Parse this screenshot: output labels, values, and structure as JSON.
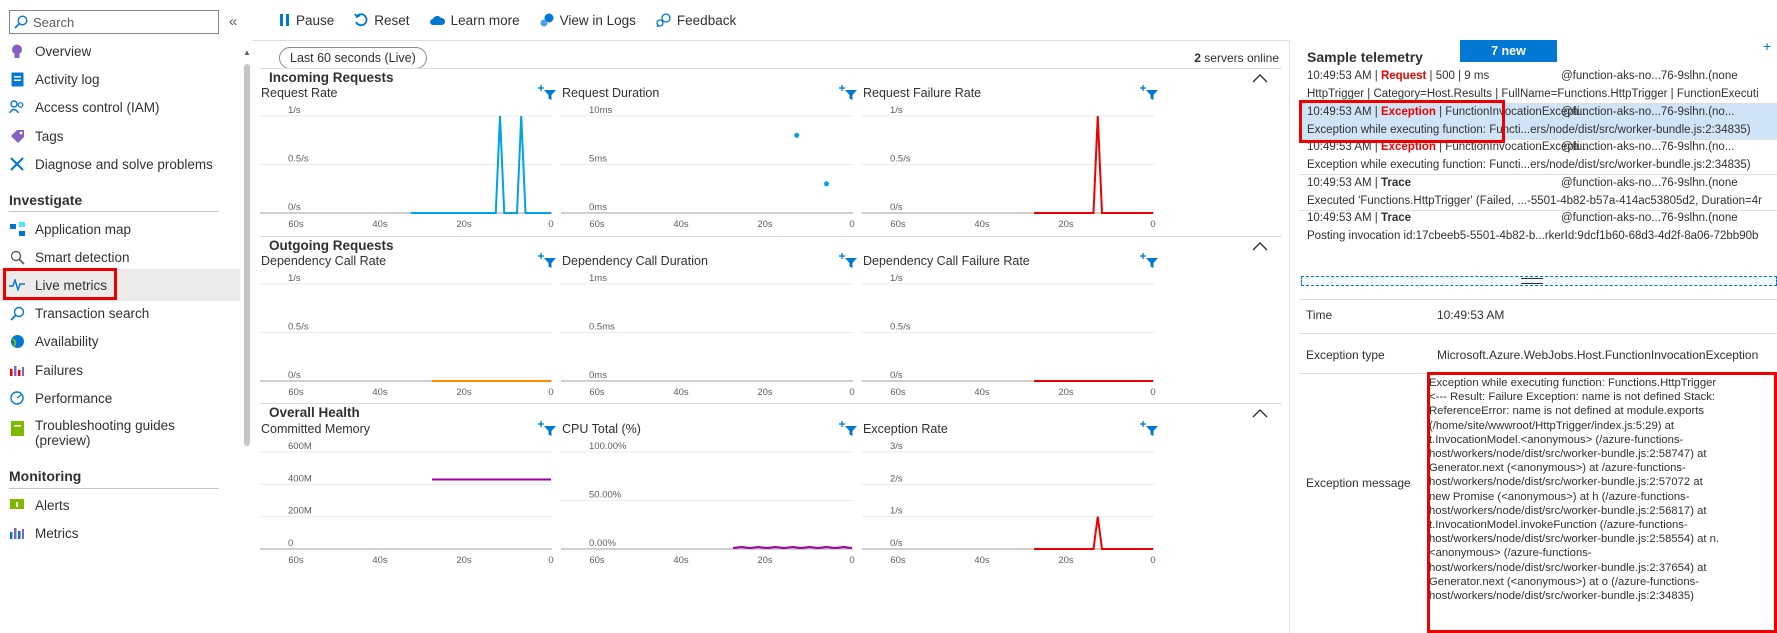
{
  "sidebar": {
    "search_placeholder": "Search",
    "items": [
      {
        "label": "Overview"
      },
      {
        "label": "Activity log"
      },
      {
        "label": "Access control (IAM)"
      },
      {
        "label": "Tags"
      },
      {
        "label": "Diagnose and solve problems"
      }
    ],
    "investigate_heading": "Investigate",
    "investigate_items": [
      {
        "label": "Application map"
      },
      {
        "label": "Smart detection"
      },
      {
        "label": "Live metrics"
      },
      {
        "label": "Transaction search"
      },
      {
        "label": "Availability"
      },
      {
        "label": "Failures"
      },
      {
        "label": "Performance"
      },
      {
        "label": "Troubleshooting guides"
      },
      {
        "label": "(preview)"
      }
    ],
    "monitoring_heading": "Monitoring",
    "monitoring_items": [
      {
        "label": "Alerts"
      },
      {
        "label": "Metrics"
      }
    ]
  },
  "toolbar": {
    "pause": "Pause",
    "reset": "Reset",
    "learn_more": "Learn more",
    "view_in_logs": "View in Logs",
    "feedback": "Feedback"
  },
  "main": {
    "time_range": "Last 60 seconds (Live)",
    "servers_count": "2",
    "servers_label": " servers online",
    "sections": [
      {
        "title": "Incoming Requests"
      },
      {
        "title": "Outgoing Requests"
      },
      {
        "title": "Overall Health"
      }
    ]
  },
  "chart_data": [
    {
      "type": "line",
      "title": "Request Rate",
      "y_ticks": [
        "1/s",
        "0.5/s",
        "0/s"
      ],
      "x_ticks": [
        "60s",
        "40s",
        "20s",
        "0"
      ],
      "x": [
        -33,
        -13,
        -12,
        -11,
        -8,
        -7,
        -6,
        0
      ],
      "series": [
        {
          "color": "#00a2e8",
          "values": [
            0,
            0,
            1,
            0,
            0,
            1,
            0,
            0
          ]
        }
      ]
    },
    {
      "type": "scatter",
      "title": "Request Duration",
      "y_ticks": [
        "10ms",
        "5ms",
        "0ms"
      ],
      "x_ticks": [
        "60s",
        "40s",
        "20s",
        "0"
      ],
      "x": [
        -13,
        -6
      ],
      "series": [
        {
          "color": "#00a2e8",
          "values": [
            8,
            3
          ]
        }
      ]
    },
    {
      "type": "line",
      "title": "Request Failure Rate",
      "y_ticks": [
        "1/s",
        "0.5/s",
        "0/s"
      ],
      "x_ticks": [
        "60s",
        "40s",
        "20s",
        "0"
      ],
      "x": [
        -28,
        -14,
        -13,
        -12,
        0
      ],
      "series": [
        {
          "color": "#e00",
          "values": [
            0,
            0,
            1,
            0,
            0
          ]
        }
      ]
    },
    {
      "type": "line",
      "title": "Dependency Call Rate",
      "y_ticks": [
        "1/s",
        "0.5/s",
        "0/s"
      ],
      "x_ticks": [
        "60s",
        "40s",
        "20s",
        "0"
      ],
      "x": [
        -28,
        0
      ],
      "series": [
        {
          "color": "#ff8c00",
          "values": [
            0,
            0
          ]
        }
      ]
    },
    {
      "type": "line",
      "title": "Dependency Call Duration",
      "y_ticks": [
        "1ms",
        "0.5ms",
        "0ms"
      ],
      "x_ticks": [
        "60s",
        "40s",
        "20s",
        "0"
      ],
      "x": [],
      "series": []
    },
    {
      "type": "line",
      "title": "Dependency Call Failure Rate",
      "y_ticks": [
        "1/s",
        "0.5/s",
        "0/s"
      ],
      "x_ticks": [
        "60s",
        "40s",
        "20s",
        "0"
      ],
      "x": [
        -28,
        0
      ],
      "series": [
        {
          "color": "#e00",
          "values": [
            0,
            0
          ]
        }
      ]
    },
    {
      "type": "line",
      "title": "Committed Memory",
      "y_ticks": [
        "600M",
        "400M",
        "200M",
        "0"
      ],
      "x_ticks": [
        "60s",
        "40s",
        "20s",
        "0"
      ],
      "x": [
        -28,
        0
      ],
      "series": [
        {
          "color": "#a0009e",
          "values": [
            430,
            430
          ]
        }
      ]
    },
    {
      "type": "line",
      "title": "CPU Total (%)",
      "y_ticks": [
        "100.00%",
        "50.00%",
        "0.00%"
      ],
      "x_ticks": [
        "60s",
        "40s",
        "20s",
        "0"
      ],
      "x": [
        -28,
        -26,
        -24,
        -22,
        -20,
        -18,
        -16,
        -14,
        -12,
        -10,
        -8,
        -6,
        -4,
        -2,
        0
      ],
      "series": [
        {
          "color": "#a0009e",
          "values": [
            1,
            2,
            1,
            2,
            1,
            2,
            1,
            2,
            1,
            2,
            1,
            2,
            1,
            2,
            1
          ]
        }
      ]
    },
    {
      "type": "line",
      "title": "Exception Rate",
      "y_ticks": [
        "3/s",
        "2/s",
        "1/s",
        "0/s"
      ],
      "x_ticks": [
        "60s",
        "40s",
        "20s",
        "0"
      ],
      "x": [
        -28,
        -14,
        -13,
        -12,
        0
      ],
      "series": [
        {
          "color": "#e00",
          "values": [
            0,
            0,
            1,
            0,
            0
          ]
        }
      ]
    }
  ],
  "telemetry": {
    "title": "Sample telemetry",
    "new_badge": "7 new",
    "rows": [
      {
        "time": "10:49:53 AM | ",
        "type": "Request",
        "rest": " | 500 | 9 ms",
        "server": "@function-aks-no...76-9slhn.(none",
        "line2": "HttpTrigger | Category=Host.Results | FullName=Functions.HttpTrigger | FunctionExecuti"
      },
      {
        "time": "10:49:53 AM | ",
        "type": "Exception",
        "rest": " | FunctionInvocationExcepti...",
        "server": "@function-aks-no...76-9slhn.(no...",
        "line2": "Exception while executing function: Functi...ers/node/dist/src/worker-bundle.js:2:34835)"
      },
      {
        "time": "10:49:53 AM | ",
        "type": "Exception",
        "rest": " | FunctionInvocationExcepti...",
        "server": "@function-aks-no...76-9slhn.(no...",
        "line2": "Exception while executing function: Functi...ers/node/dist/src/worker-bundle.js:2:34835)"
      },
      {
        "time": "10:49:53 AM | ",
        "type": "Trace",
        "rest": "",
        "server": "@function-aks-no...76-9slhn.(none",
        "line2": "Executed 'Functions.HttpTrigger' (Failed, ...-5501-4b82-b57a-414ac53805d2, Duration=4r"
      },
      {
        "time": "10:49:53 AM | ",
        "type": "Trace",
        "rest": "",
        "server": "@function-aks-no...76-9slhn.(none",
        "line2": "Posting invocation id:17cbeeb5-5501-4b82-b...rkerId:9dcf1b60-68d3-4d2f-8a06-72bb90b"
      }
    ],
    "details": {
      "time_label": "Time",
      "time_value": "10:49:53 AM",
      "type_label": "Exception type",
      "type_value": "Microsoft.Azure.WebJobs.Host.FunctionInvocationException",
      "message_label": "Exception message",
      "message_value": "Exception while executing function: Functions.HttpTrigger\n<--- Result: Failure Exception: name is not defined Stack:\nReferenceError: name is not defined at module.exports\n(/home/site/wwwroot/HttpTrigger/index.js:5:29) at\nt.InvocationModel.<anonymous> (/azure-functions-\nhost/workers/node/dist/src/worker-bundle.js:2:58747) at\nGenerator.next (<anonymous>) at /azure-functions-\nhost/workers/node/dist/src/worker-bundle.js:2:57072 at\nnew Promise (<anonymous>) at h (/azure-functions-\nhost/workers/node/dist/src/worker-bundle.js:2:56817) at\nt.InvocationModel.invokeFunction (/azure-functions-\nhost/workers/node/dist/src/worker-bundle.js:2:58554) at n.\n<anonymous> (/azure-functions-\nhost/workers/node/dist/src/worker-bundle.js:2:37654) at\nGenerator.next (<anonymous>) at o (/azure-functions-\nhost/workers/node/dist/src/worker-bundle.js:2:34835)"
    }
  },
  "colors": {
    "accent": "#0078d4",
    "error": "#e00",
    "highlight_box": "#e00",
    "request_line": "#00a2e8",
    "dependency_line": "#ff8c00",
    "health_line": "#a0009e"
  }
}
